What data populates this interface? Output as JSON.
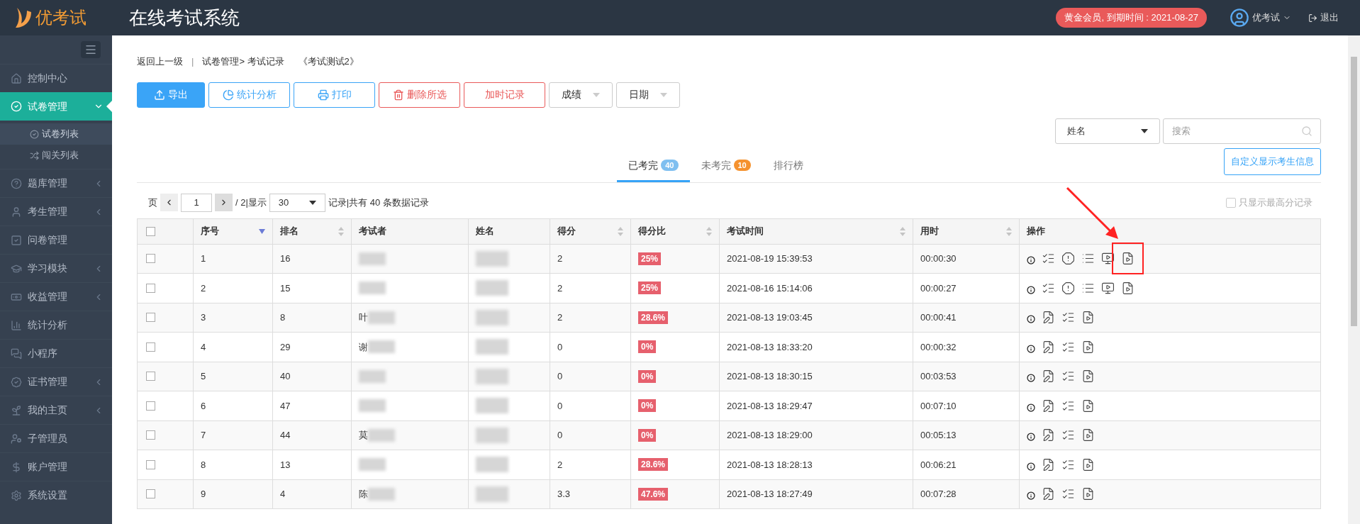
{
  "header": {
    "logo": "优考试",
    "title": "在线考试系统",
    "membership": "黄金会员, 到期时间 : 2021-08-27",
    "user": "优考试",
    "logout": "退出"
  },
  "sidebar": {
    "items": [
      {
        "label": "控制中心",
        "selected": false
      },
      {
        "label": "试卷管理",
        "selected": true,
        "expanded": true,
        "children": [
          {
            "label": "试卷列表",
            "selected": true
          },
          {
            "label": "闯关列表",
            "selected": false
          }
        ]
      },
      {
        "label": "题库管理",
        "selected": false,
        "expanded": false
      },
      {
        "label": "考生管理",
        "selected": false,
        "expanded": false
      },
      {
        "label": "问卷管理",
        "selected": false
      },
      {
        "label": "学习模块",
        "selected": false,
        "expanded": false
      },
      {
        "label": "收益管理",
        "selected": false,
        "expanded": false
      },
      {
        "label": "统计分析",
        "selected": false
      },
      {
        "label": "小程序",
        "selected": false
      },
      {
        "label": "证书管理",
        "selected": false,
        "expanded": false
      },
      {
        "label": "我的主页",
        "selected": false,
        "expanded": false
      },
      {
        "label": "子管理员",
        "selected": false
      },
      {
        "label": "账户管理",
        "selected": false
      },
      {
        "label": "系统设置",
        "selected": false
      }
    ]
  },
  "breadcrumb": {
    "back": "返回上一级",
    "separator": "|",
    "path": "试卷管理> 考试记录",
    "exam": "《考试测试2》"
  },
  "toolbar": [
    {
      "label": "导出",
      "kind": "primary"
    },
    {
      "label": "统计分析",
      "kind": "info"
    },
    {
      "label": "打印",
      "kind": "info"
    },
    {
      "label": "删除所选",
      "kind": "danger"
    },
    {
      "label": "加时记录",
      "kind": "danger"
    },
    {
      "label": "成绩",
      "kind": "dropdown"
    },
    {
      "label": "日期",
      "kind": "dropdown"
    }
  ],
  "search": {
    "field_select": "姓名",
    "placeholder": "搜索"
  },
  "tabs": [
    {
      "label": "已考完",
      "count": "40",
      "color": "#7fbff0",
      "selected": true
    },
    {
      "label": "未考完",
      "count": "10",
      "color": "#f5922f",
      "selected": false
    },
    {
      "label": "排行榜",
      "selected": false
    }
  ],
  "custom_button": "自定义显示考生信息",
  "pager": {
    "prefix": "页",
    "page": "1",
    "total": "/ 2|显示",
    "per_page": "30",
    "summary": "记录|共有 40 条数据记录"
  },
  "best_only": {
    "label": "只显示最高分记录",
    "checked": false
  },
  "table": {
    "select_all": {
      "checked": false
    },
    "columns": [
      {
        "label": "序号",
        "sorted": true
      },
      {
        "label": "排名",
        "sorted": false
      },
      {
        "label": "考试者"
      },
      {
        "label": "姓名"
      },
      {
        "label": "得分",
        "sorted": false
      },
      {
        "label": "得分比",
        "sorted": false
      },
      {
        "label": "考试时间",
        "sorted": false
      },
      {
        "label": "用时",
        "sorted": false
      },
      {
        "label": "操作"
      }
    ],
    "rows": [
      {
        "checked": false,
        "no": "1",
        "rank": "16",
        "score": "2",
        "percent": "25%",
        "time": "2021-08-19 15:39:53",
        "duration": "00:00:30",
        "actions": [
          {
            "kind": "info",
            "highlighted": false
          },
          {
            "kind": "detail",
            "highlighted": false
          },
          {
            "kind": "alert",
            "highlighted": false
          },
          {
            "kind": "list",
            "highlighted": false
          },
          {
            "kind": "screen",
            "highlighted": false
          },
          {
            "kind": "video",
            "highlighted": true
          }
        ]
      },
      {
        "checked": false,
        "no": "2",
        "rank": "15",
        "score": "2",
        "percent": "25%",
        "time": "2021-08-16 15:14:06",
        "duration": "00:00:27",
        "actions": [
          {
            "kind": "info",
            "highlighted": false
          },
          {
            "kind": "detail",
            "highlighted": false
          },
          {
            "kind": "alert",
            "highlighted": false
          },
          {
            "kind": "list",
            "highlighted": false
          },
          {
            "kind": "screen",
            "highlighted": false
          },
          {
            "kind": "video",
            "highlighted": false
          }
        ]
      },
      {
        "checked": false,
        "no": "3",
        "rank": "8",
        "examinee": "叶",
        "score": "2",
        "percent": "28.6%",
        "time": "2021-08-13 19:03:45",
        "duration": "00:00:41",
        "actions": [
          {
            "kind": "info",
            "highlighted": false
          },
          {
            "kind": "edit",
            "highlighted": false
          },
          {
            "kind": "detail",
            "highlighted": false
          },
          {
            "kind": "video",
            "highlighted": false
          }
        ]
      },
      {
        "checked": false,
        "no": "4",
        "rank": "29",
        "examinee": "谢",
        "score": "0",
        "percent": "0%",
        "time": "2021-08-13 18:33:20",
        "duration": "00:00:32",
        "actions": [
          {
            "kind": "info",
            "highlighted": false
          },
          {
            "kind": "edit",
            "highlighted": false
          },
          {
            "kind": "detail",
            "highlighted": false
          },
          {
            "kind": "video",
            "highlighted": false
          }
        ]
      },
      {
        "checked": false,
        "no": "5",
        "rank": "40",
        "score": "0",
        "percent": "0%",
        "time": "2021-08-13 18:30:15",
        "duration": "00:03:53",
        "actions": [
          {
            "kind": "info",
            "highlighted": false
          },
          {
            "kind": "edit",
            "highlighted": false
          },
          {
            "kind": "detail",
            "highlighted": false
          },
          {
            "kind": "video",
            "highlighted": false
          }
        ]
      },
      {
        "checked": false,
        "no": "6",
        "rank": "47",
        "score": "0",
        "percent": "0%",
        "time": "2021-08-13 18:29:47",
        "duration": "00:07:10",
        "actions": [
          {
            "kind": "info",
            "highlighted": false
          },
          {
            "kind": "edit",
            "highlighted": false
          },
          {
            "kind": "detail",
            "highlighted": false
          },
          {
            "kind": "video",
            "highlighted": false
          }
        ]
      },
      {
        "checked": false,
        "no": "7",
        "rank": "44",
        "examinee": "莫",
        "score": "0",
        "percent": "0%",
        "time": "2021-08-13 18:29:00",
        "duration": "00:05:13",
        "actions": [
          {
            "kind": "info",
            "highlighted": false
          },
          {
            "kind": "edit",
            "highlighted": false
          },
          {
            "kind": "detail",
            "highlighted": false
          },
          {
            "kind": "video",
            "highlighted": false
          }
        ]
      },
      {
        "checked": false,
        "no": "8",
        "rank": "13",
        "score": "2",
        "percent": "28.6%",
        "time": "2021-08-13 18:28:13",
        "duration": "00:06:21",
        "actions": [
          {
            "kind": "info",
            "highlighted": false
          },
          {
            "kind": "edit",
            "highlighted": false
          },
          {
            "kind": "detail",
            "highlighted": false
          },
          {
            "kind": "video",
            "highlighted": false
          }
        ]
      },
      {
        "checked": false,
        "no": "9",
        "rank": "4",
        "examinee": "陈",
        "score": "3.3",
        "percent": "47.6%",
        "time": "2021-08-13 18:27:49",
        "duration": "00:07:28",
        "actions": [
          {
            "kind": "info",
            "highlighted": false
          },
          {
            "kind": "edit",
            "highlighted": false
          },
          {
            "kind": "detail",
            "highlighted": false
          },
          {
            "kind": "video",
            "highlighted": false
          }
        ]
      }
    ]
  }
}
